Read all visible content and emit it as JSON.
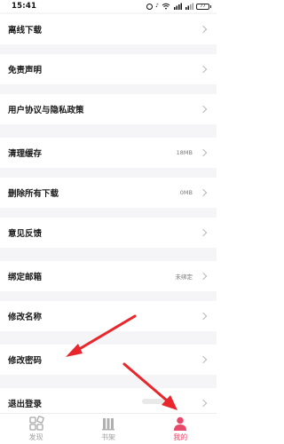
{
  "status_bar": {
    "time": "15:41",
    "battery": "77",
    "icons": [
      "alarm-icon",
      "mute-icon",
      "wifi-icon",
      "hd-signal-icon",
      "signal-icon",
      "battery-icon"
    ]
  },
  "settings": {
    "items": [
      {
        "label": "离线下载",
        "value": ""
      },
      {
        "label": "免责声明",
        "value": ""
      },
      {
        "label": "用户协议与隐私政策",
        "value": ""
      },
      {
        "label": "清理缓存",
        "value": "18MB"
      },
      {
        "label": "删除所有下载",
        "value": "0MB"
      },
      {
        "label": "意见反馈",
        "value": ""
      },
      {
        "label": "绑定邮箱",
        "value": "未绑定"
      },
      {
        "label": "修改名称",
        "value": ""
      },
      {
        "label": "修改密码",
        "value": ""
      },
      {
        "label": "退出登录",
        "value": ""
      }
    ]
  },
  "tab_bar": {
    "tabs": [
      {
        "label": "发现",
        "icon": "discover-icon",
        "active": false
      },
      {
        "label": "书架",
        "icon": "bookshelf-icon",
        "active": false
      },
      {
        "label": "我的",
        "icon": "profile-icon",
        "active": true
      }
    ]
  },
  "colors": {
    "accent": "#e8496a",
    "arrow": "#e8262b",
    "background": "#f5f5f7",
    "inactive_tab": "#a0a0a0"
  }
}
